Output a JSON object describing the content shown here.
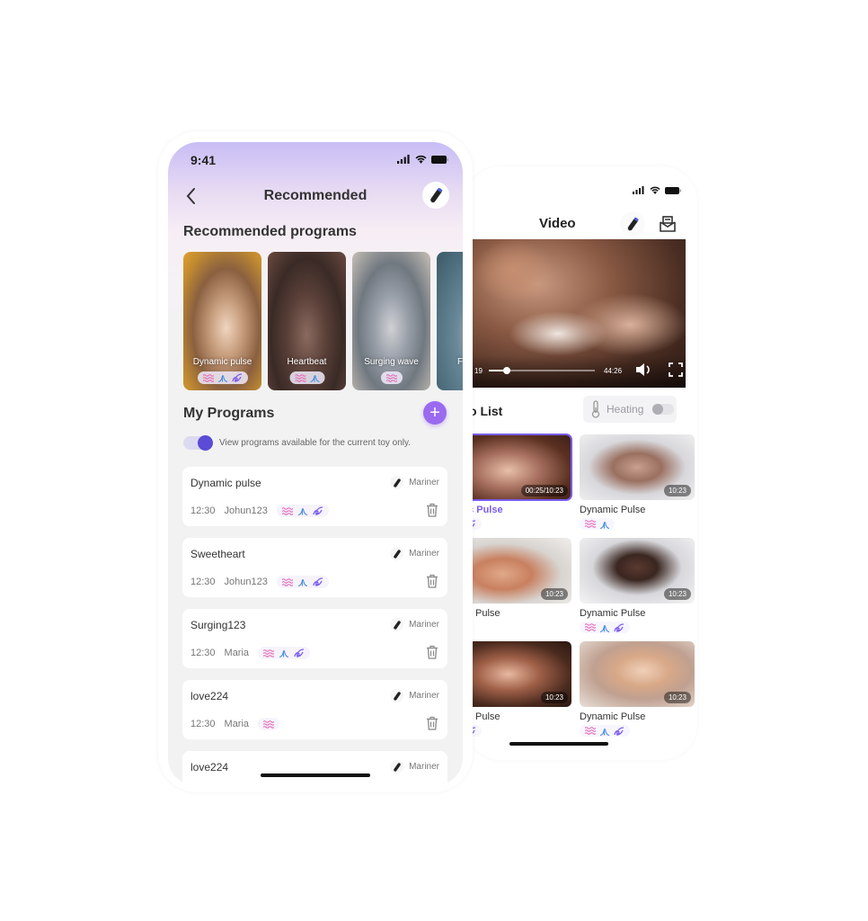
{
  "left_phone": {
    "status_bar": {
      "time": "9:41"
    },
    "header": {
      "title": "Recommended",
      "back_icon": "chevron-left-icon",
      "toy_icon": "toy-icon"
    },
    "recommended": {
      "section_title": "Recommended programs",
      "cards": [
        {
          "label": "Dynamic pulse",
          "tags": [
            "wave",
            "peak",
            "swirl"
          ]
        },
        {
          "label": "Heartbeat",
          "tags": [
            "wave",
            "peak"
          ]
        },
        {
          "label": "Surging wave",
          "tags": [
            "wave"
          ]
        },
        {
          "label": "F",
          "tags": []
        }
      ]
    },
    "my_programs": {
      "section_title": "My Programs",
      "add_label": "+",
      "filter_label": "View programs available for the current toy only.",
      "filter_on": true,
      "items": [
        {
          "name": "Dynamic pulse",
          "toy": "Mariner",
          "time": "12:30",
          "author": "Johun123",
          "tags": [
            "wave",
            "peak",
            "swirl"
          ]
        },
        {
          "name": "Sweetheart",
          "toy": "Mariner",
          "time": "12:30",
          "author": "Johun123",
          "tags": [
            "wave",
            "peak",
            "swirl"
          ]
        },
        {
          "name": "Surging123",
          "toy": "Mariner",
          "time": "12:30",
          "author": "Maria",
          "tags": [
            "wave",
            "peak",
            "swirl"
          ]
        },
        {
          "name": "love224",
          "toy": "Mariner",
          "time": "12:30",
          "author": "Maria",
          "tags": [
            "wave"
          ]
        },
        {
          "name": "love224",
          "toy": "Mariner",
          "time": "",
          "author": "",
          "tags": []
        }
      ]
    }
  },
  "right_phone": {
    "header": {
      "title": "Video",
      "toy_icon": "toy-icon",
      "inbox_icon": "inbox-icon"
    },
    "player": {
      "current_time": "19",
      "total_time": "44:26",
      "progress": 0.17
    },
    "list": {
      "title": "o List",
      "heating_label": "Heating",
      "heating_on": false,
      "videos": [
        {
          "title": "ic Pulse",
          "duration": "00:25/10:23",
          "active": true,
          "tags": [
            "swirl"
          ]
        },
        {
          "title": "Dynamic Pulse",
          "duration": "10:23",
          "active": false,
          "tags": [
            "wave",
            "peak"
          ]
        },
        {
          "title": "ic Pulse",
          "duration": "10:23",
          "active": false,
          "tags": []
        },
        {
          "title": "Dynamic Pulse",
          "duration": "10:23",
          "active": false,
          "tags": [
            "wave",
            "peak",
            "swirl"
          ]
        },
        {
          "title": "ic Pulse",
          "duration": "10:23",
          "active": false,
          "tags": [
            "swirl"
          ]
        },
        {
          "title": "Dynamic Pulse",
          "duration": "10:23",
          "active": false,
          "tags": [
            "wave",
            "peak",
            "swirl"
          ]
        }
      ]
    }
  },
  "colors": {
    "accent": "#7a5cf0",
    "add_button": "#9a6af0",
    "toggle_knob": "#5b4bd6",
    "tag_wave": "#e45fb3",
    "tag_peak": "#4a8fe0",
    "tag_swirl": "#7a5cf0"
  }
}
